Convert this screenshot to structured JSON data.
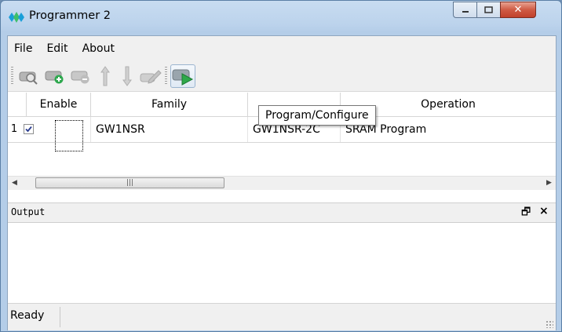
{
  "window": {
    "title": "Programmer 2"
  },
  "menu": {
    "items": [
      "File",
      "Edit",
      "About"
    ]
  },
  "toolbar": {
    "buttons": [
      "scan-device-icon",
      "add-device-icon",
      "remove-device-icon",
      "move-up-icon",
      "move-down-icon",
      "edit-device-icon",
      "program-configure-icon"
    ],
    "tooltip": "Program/Configure"
  },
  "table": {
    "headers": [
      "Enable",
      "Family",
      "",
      "Operation"
    ],
    "rows": [
      {
        "num": "1",
        "enabled": true,
        "family": "GW1NSR",
        "device": "GW1NSR-2C",
        "operation": "SRAM Program"
      }
    ]
  },
  "output": {
    "title": "Output"
  },
  "status": {
    "text": "Ready"
  }
}
